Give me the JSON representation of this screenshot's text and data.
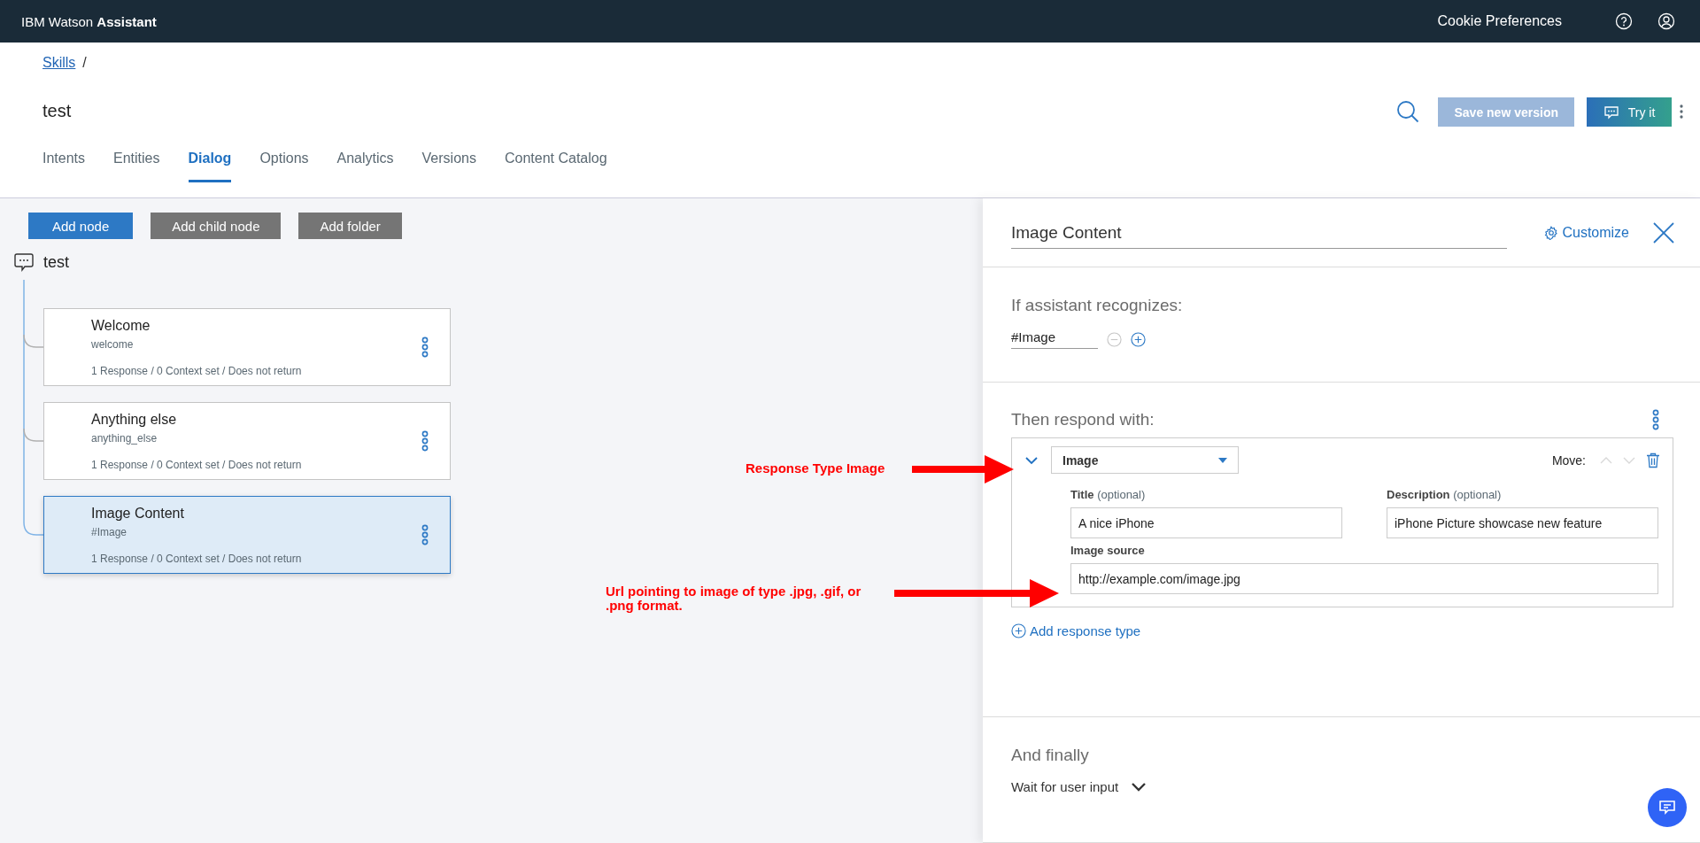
{
  "topbar": {
    "brand": "IBM Watson **Assistant**",
    "links": [
      "Cookie Preferences"
    ]
  },
  "header": {
    "breadcrumb": {
      "links": [
        "Skills"
      ],
      "separator": "/"
    },
    "title": "test",
    "save_button": {
      "label": "Save new version",
      "disabled": true
    },
    "try_button": {
      "label": "Try it"
    }
  },
  "tabs": [
    {
      "label": "Intents",
      "selected": false
    },
    {
      "label": "Entities",
      "selected": false
    },
    {
      "label": "Dialog",
      "selected": true
    },
    {
      "label": "Options",
      "selected": false
    },
    {
      "label": "Analytics",
      "selected": false
    },
    {
      "label": "Versions",
      "selected": false
    },
    {
      "label": "Content Catalog",
      "selected": false
    }
  ],
  "dialog_tree": {
    "buttons": [
      {
        "label": "Add node",
        "kind": "primary"
      },
      {
        "label": "Add child node",
        "kind": "secondary"
      },
      {
        "label": "Add folder",
        "kind": "secondary"
      }
    ],
    "root": "test",
    "nodes": [
      {
        "title": "Welcome",
        "condition": "welcome",
        "summary": "1 Response / 0 Context set / Does not return",
        "selected": false
      },
      {
        "title": "Anything else",
        "condition": "anything_else",
        "summary": "1 Response / 0 Context set / Does not return",
        "selected": false
      },
      {
        "title": "Image Content",
        "condition": "#Image",
        "summary": "1 Response / 0 Context set / Does not return",
        "selected": true
      }
    ]
  },
  "annotations": [
    {
      "text": "Response Type Image"
    },
    {
      "text": "Url pointing to image of type .jpg, .gif, or .png format."
    }
  ],
  "node_editor": {
    "name": "Image Content",
    "customize": "Customize",
    "condition_heading": "If assistant recognizes:",
    "conditions": [
      "#Image"
    ],
    "response_heading": "Then respond with:",
    "response": {
      "type": "Image",
      "expanded": true,
      "move_label": "Move:",
      "fields": [
        {
          "label": "Title",
          "hint": "(optional)",
          "value": "A nice iPhone"
        },
        {
          "label": "Description",
          "hint": "(optional)",
          "value": "iPhone Picture showcase new feature"
        },
        {
          "label": "Image source",
          "value": "http://example.com/image.jpg"
        }
      ]
    },
    "add_response": "Add response type",
    "final_heading": "And finally",
    "final_action": "Wait for user input"
  }
}
